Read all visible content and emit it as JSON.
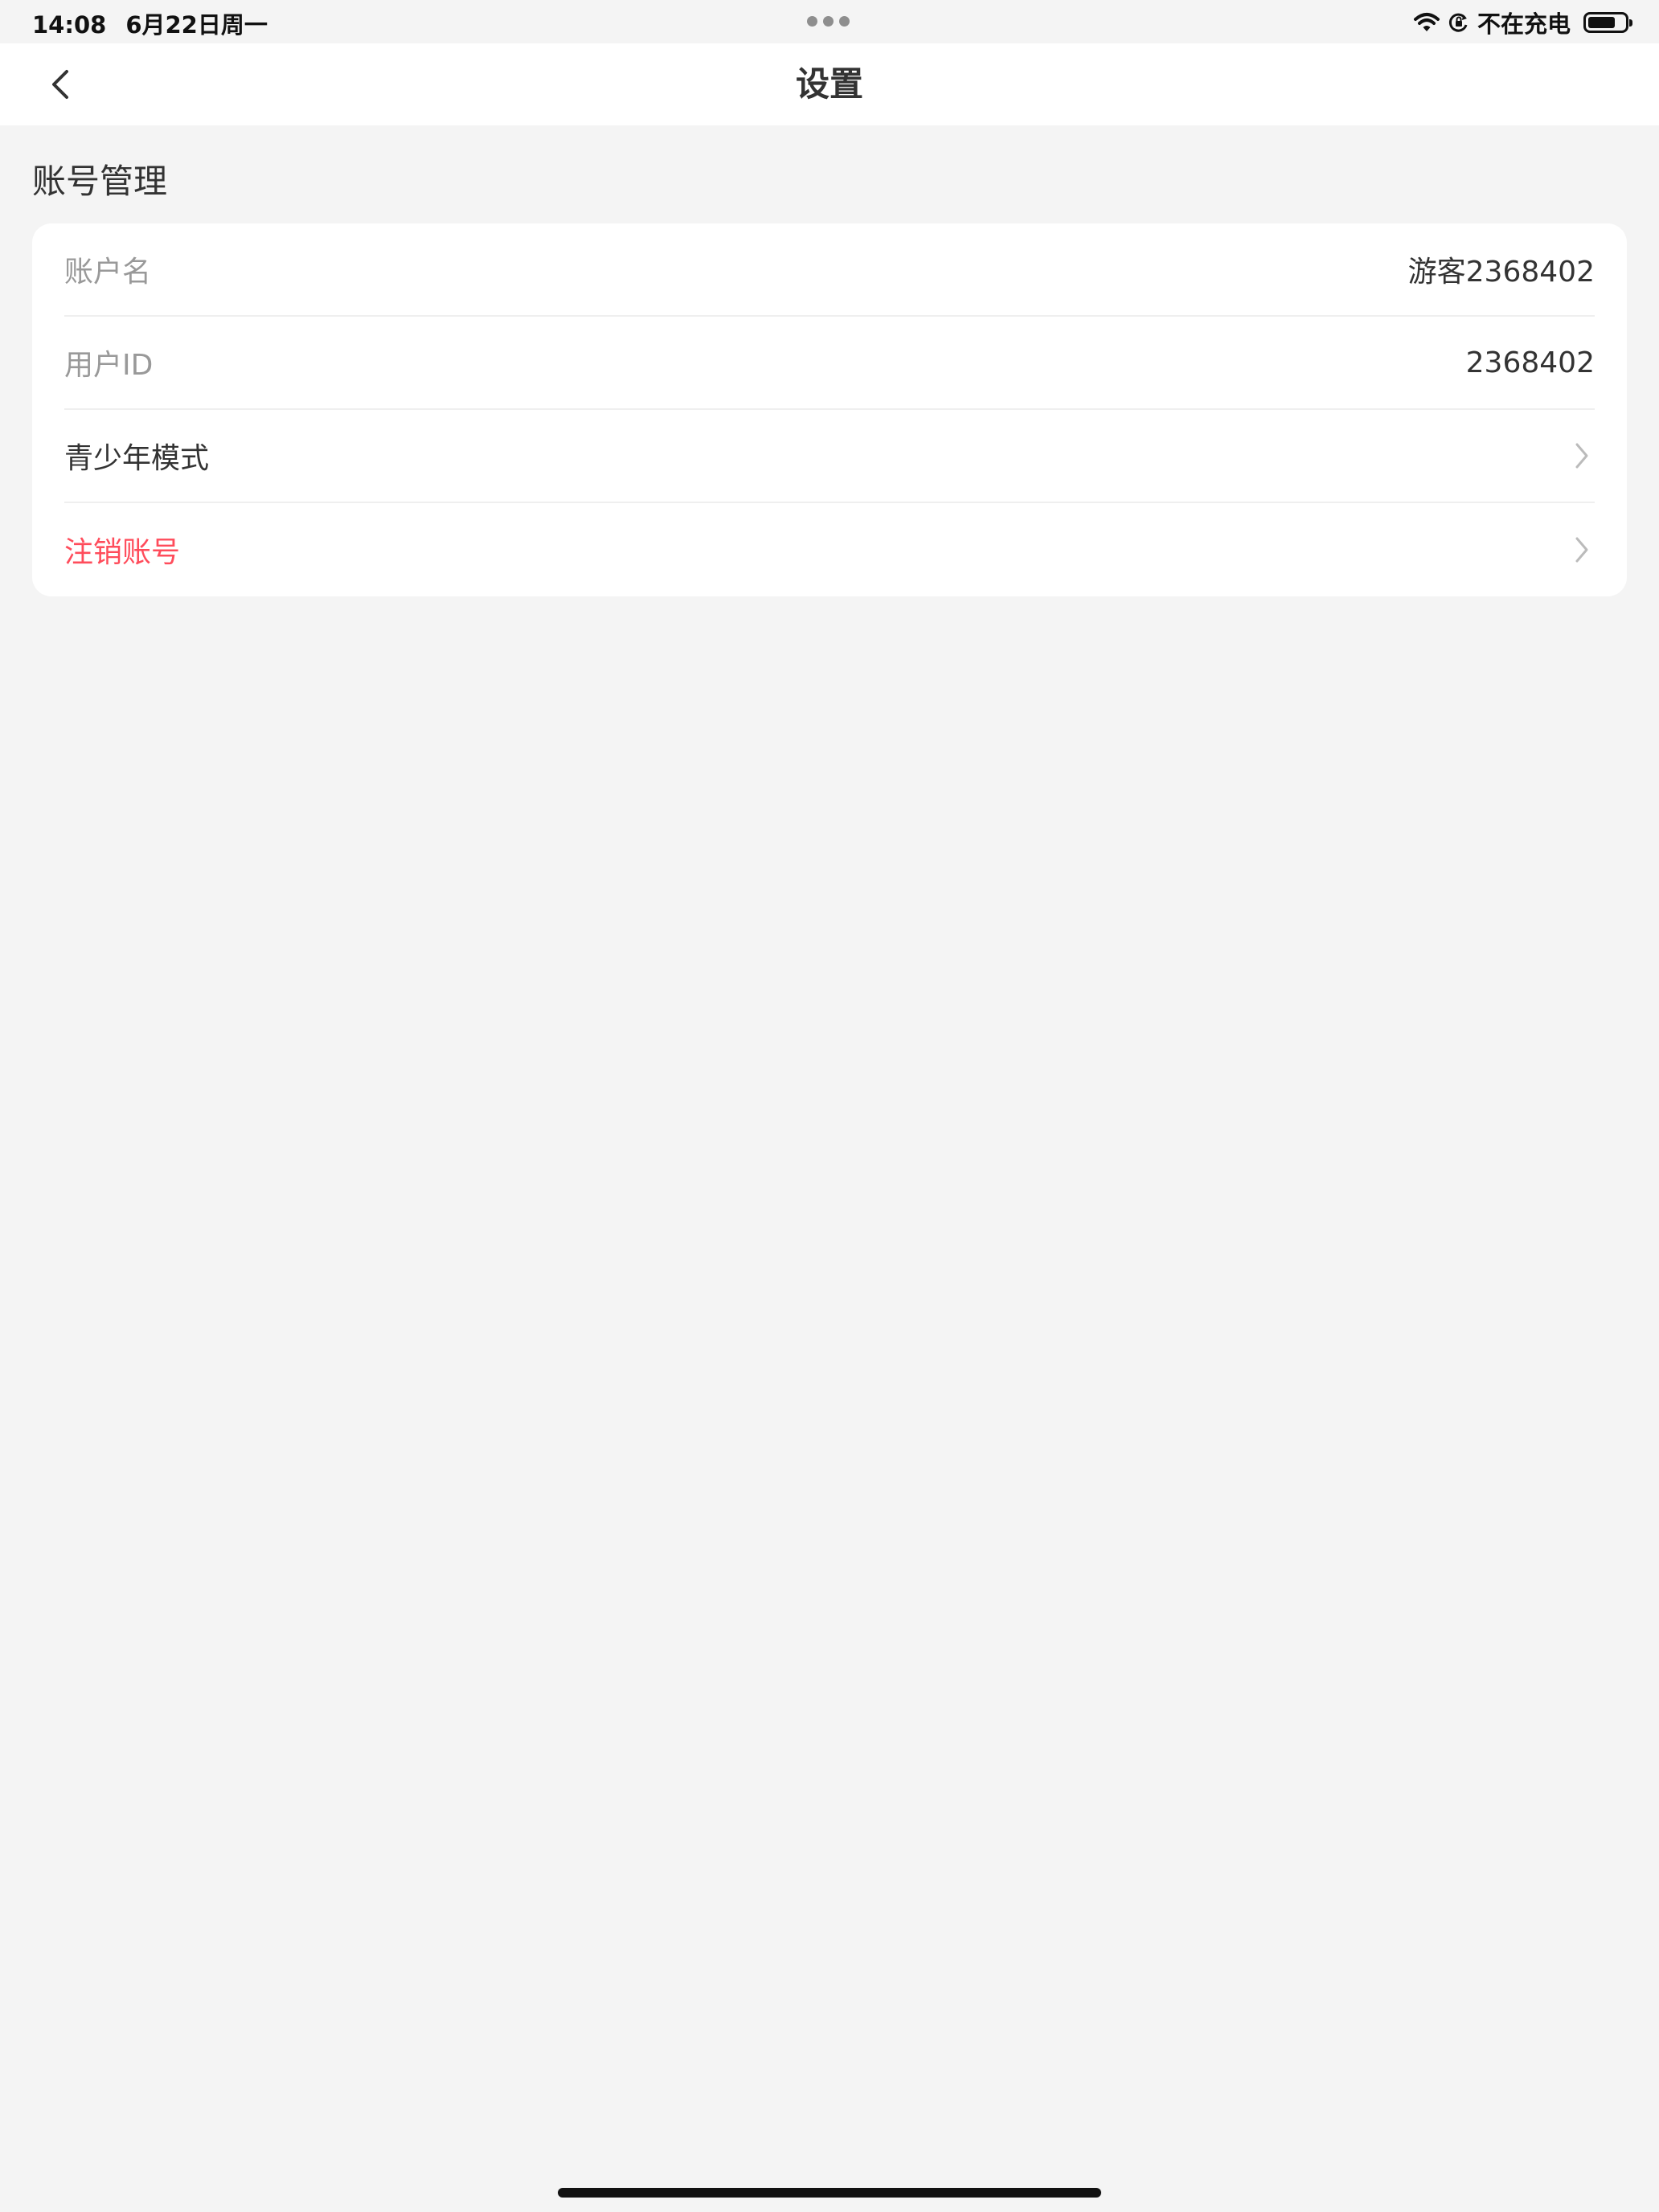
{
  "status_bar": {
    "time": "14:08",
    "date": "6月22日周一",
    "charging_text": "不在充电",
    "battery_level": 0.75
  },
  "nav": {
    "title": "设置"
  },
  "account_section": {
    "title": "账号管理",
    "rows": [
      {
        "label": "账户名",
        "value": "游客2368402"
      },
      {
        "label": "用户ID",
        "value": "2368402"
      },
      {
        "label": "青少年模式"
      },
      {
        "label": "注销账号"
      }
    ]
  },
  "colors": {
    "background": "#f4f4f4",
    "card": "#ffffff",
    "danger": "#ff4c5b",
    "muted_text": "#999999",
    "primary_text": "#333333"
  }
}
